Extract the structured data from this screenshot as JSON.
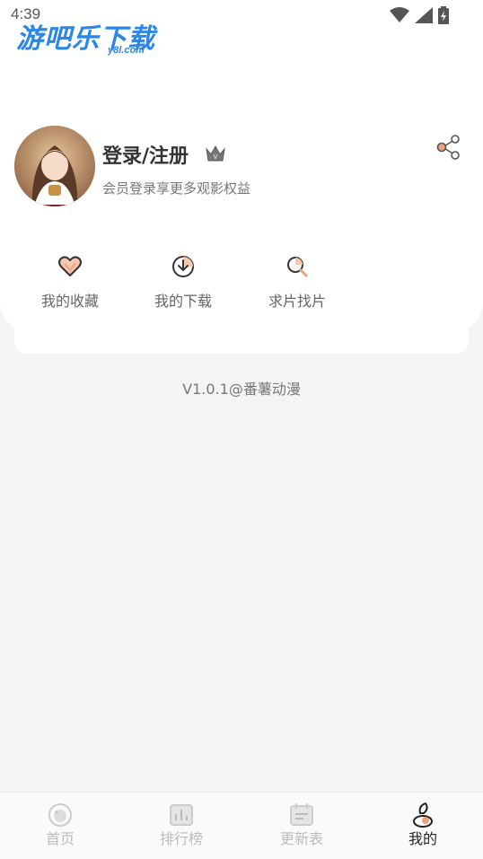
{
  "status_bar": {
    "time": "4:39"
  },
  "watermark": {
    "text": "游吧乐下载",
    "sub": "y8l.com"
  },
  "profile": {
    "title": "登录/注册",
    "subtitle": "会员登录享更多观影权益"
  },
  "quick_actions": [
    {
      "label": "我的收藏",
      "icon": "heart-icon"
    },
    {
      "label": "我的下载",
      "icon": "download-icon"
    },
    {
      "label": "求片找片",
      "icon": "search-icon"
    }
  ],
  "version": "V1.0.1@番薯动漫",
  "bottom_nav": [
    {
      "label": "首页",
      "icon": "home-icon",
      "active": false
    },
    {
      "label": "排行榜",
      "icon": "ranking-icon",
      "active": false
    },
    {
      "label": "更新表",
      "icon": "calendar-icon",
      "active": false
    },
    {
      "label": "我的",
      "icon": "profile-icon",
      "active": true
    }
  ],
  "colors": {
    "accent": "#f0a27c",
    "active_text": "#222222",
    "inactive_text": "#bbbbbb"
  }
}
